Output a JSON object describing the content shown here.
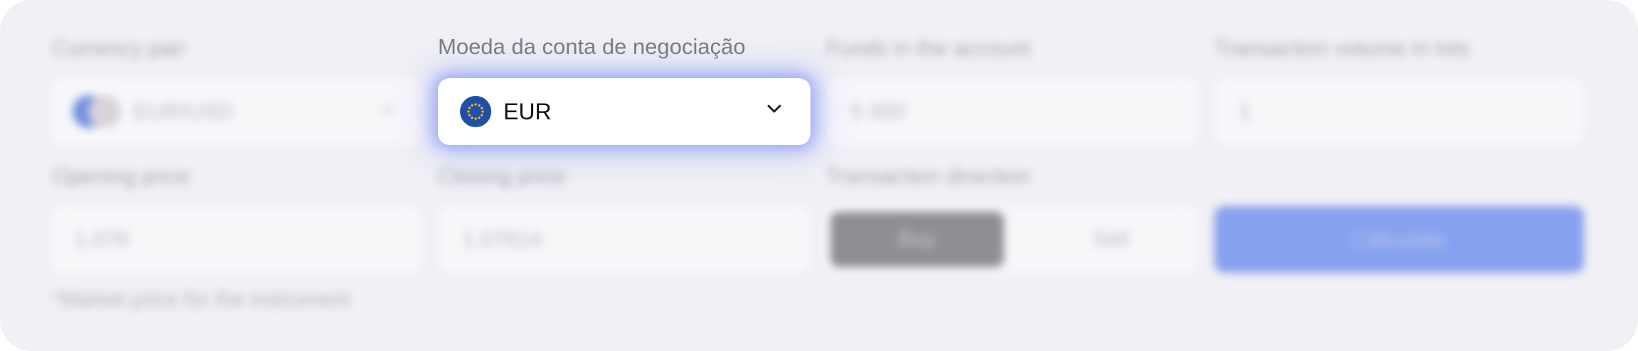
{
  "calculator": {
    "currency_pair": {
      "label": "Currency pair",
      "value": "EUR/USD"
    },
    "account_currency": {
      "label": "Moeda da conta de negociação",
      "value": "EUR",
      "icon": "eu-flag-icon"
    },
    "funds": {
      "label": "Funds in the account",
      "value": "5 000"
    },
    "volume": {
      "label": "Transaction volume in lots",
      "value": "1"
    },
    "opening_price": {
      "label": "Opening price",
      "value": "1.076"
    },
    "closing_price": {
      "label": "Closing price",
      "value": "1.07614"
    },
    "direction": {
      "label": "Transaction direction",
      "buy_label": "Buy",
      "sell_label": "Sell",
      "selected": "Buy"
    },
    "calculate_label": "Calculate",
    "hint": "*Market price for the instrument"
  },
  "colors": {
    "panel_background": "#f0f0f5",
    "accent": "#86a1ee",
    "focus_glow": "#6e82f5",
    "flag_blue": "#1f4fa8",
    "flag_stars": "#f4c21c"
  }
}
